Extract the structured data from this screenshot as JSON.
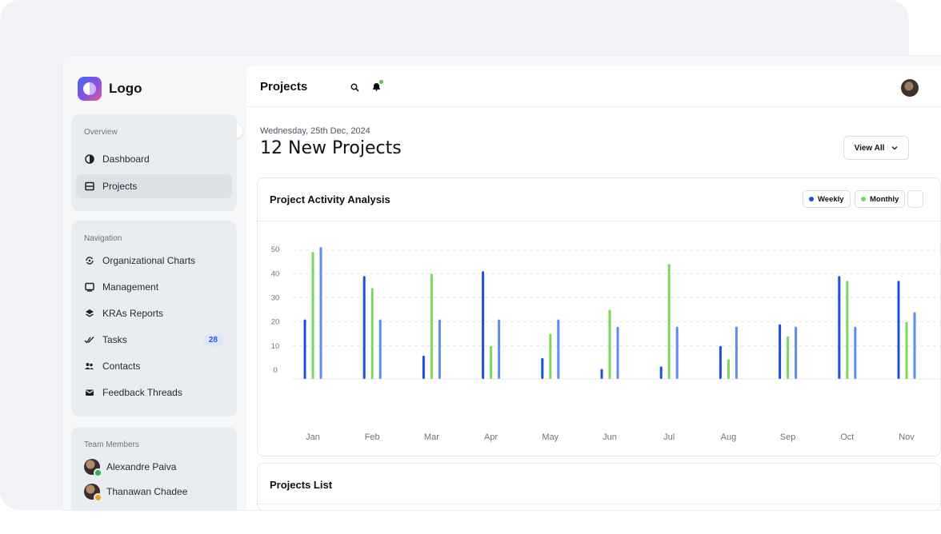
{
  "sidebar": {
    "logo_text": "Logo",
    "overview": {
      "heading": "Overview",
      "items": [
        {
          "label": "Dashboard",
          "icon": "dashboard-icon"
        },
        {
          "label": "Projects",
          "icon": "projects-icon",
          "active": true
        }
      ]
    },
    "navigation": {
      "heading": "Navigation",
      "items": [
        {
          "label": "Organizational Charts",
          "icon": "org-chart-icon"
        },
        {
          "label": "Management",
          "icon": "management-icon"
        },
        {
          "label": "KRAs Reports",
          "icon": "layers-icon"
        },
        {
          "label": "Tasks",
          "icon": "check-icon",
          "badge": "28"
        },
        {
          "label": "Contacts",
          "icon": "contacts-icon"
        },
        {
          "label": "Feedback Threads",
          "icon": "mail-icon"
        }
      ]
    },
    "team": {
      "heading": "Team Members",
      "members": [
        {
          "name": "Alexandre Paiva",
          "status_color": "#2fb64a"
        },
        {
          "name": "Thanawan Chadee",
          "status_color": "#f0a020"
        }
      ]
    }
  },
  "header": {
    "title": "Projects",
    "icons": [
      "search-icon",
      "bell-icon"
    ]
  },
  "summary": {
    "date": "Wednesday, 25th Dec, 2024",
    "headline": "12 New Projects",
    "view_all_label": "View All"
  },
  "chart_card": {
    "title": "Project Activity Analysis",
    "legend": [
      {
        "label": "Weekly",
        "color": "#1a4fe0"
      },
      {
        "label": "Monthly",
        "color": "#7ad85a"
      }
    ]
  },
  "list_card": {
    "title": "Projects List"
  },
  "colors": {
    "accent_blue": "#1a4fe0",
    "accent_green": "#7ad85a",
    "accent_light_blue": "#5b8ef0"
  },
  "chart_data": {
    "type": "bar",
    "categories": [
      "Jan",
      "Feb",
      "Mar",
      "Apr",
      "May",
      "Jun",
      "Jul",
      "Aug",
      "Sep",
      "Oct",
      "Nov"
    ],
    "y_ticks": [
      0,
      10,
      20,
      30,
      40,
      50
    ],
    "ylim": [
      -3,
      55
    ],
    "grid": true,
    "legend_position": "top-right",
    "series": [
      {
        "name": "Weekly",
        "color": "#1a4fe0",
        "values": [
          21,
          39,
          6,
          41,
          5,
          0.5,
          1.5,
          10,
          19,
          39,
          37
        ]
      },
      {
        "name": "Monthly",
        "color": "#7ad85a",
        "values": [
          49,
          34,
          40,
          10,
          15,
          25,
          44,
          4.5,
          14,
          37,
          20
        ]
      },
      {
        "color": "#5b8ef0",
        "values": [
          51,
          21,
          21,
          21,
          21,
          18,
          18,
          18,
          18,
          18,
          24
        ]
      }
    ]
  }
}
